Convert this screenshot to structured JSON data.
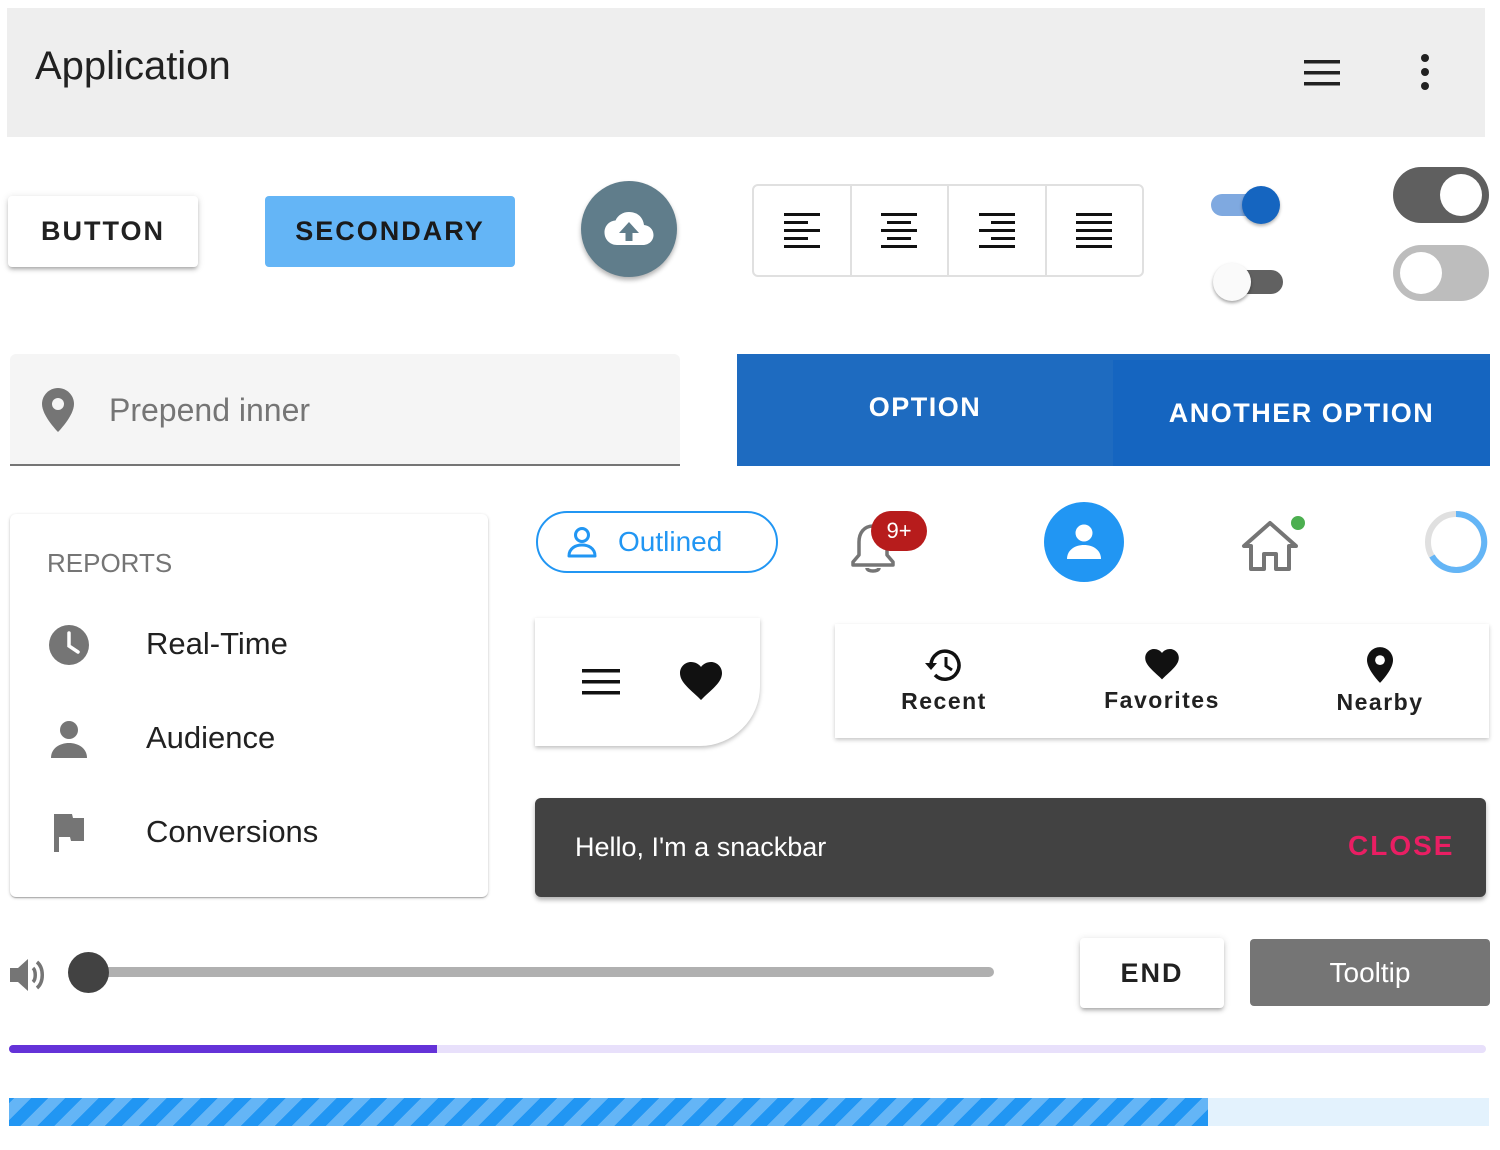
{
  "appbar": {
    "title": "Application",
    "menu_icon": "menu-icon",
    "more_icon": "more-vert-icon"
  },
  "buttons": {
    "elevated_label": "BUTTON",
    "secondary_label": "SECONDARY",
    "fab_icon": "cloud-upload-icon",
    "end_label": "END"
  },
  "toggle_group": {
    "items": [
      "align-left-icon",
      "align-center-icon",
      "align-right-icon",
      "align-justify-icon"
    ]
  },
  "switches": {
    "first": true,
    "second": false,
    "third": true,
    "fourth": false
  },
  "textfield": {
    "placeholder": "Prepend inner",
    "icon": "map-marker-icon"
  },
  "tabs": [
    {
      "label": "OPTION"
    },
    {
      "label": "ANOTHER OPTION"
    }
  ],
  "reports": {
    "header": "REPORTS",
    "items": [
      {
        "label": "Real-Time",
        "icon": "clock-icon"
      },
      {
        "label": "Audience",
        "icon": "account-icon"
      },
      {
        "label": "Conversions",
        "icon": "flag-icon"
      }
    ]
  },
  "chip": {
    "label": "Outlined",
    "icon": "account-outline-icon"
  },
  "badge": {
    "count": "9+",
    "icon": "bell-outline-icon"
  },
  "avatar": {
    "icon": "account-icon"
  },
  "home": {
    "icon": "home-outline-icon"
  },
  "bottom_nav": {
    "items": [
      {
        "label": "Recent",
        "icon": "history-icon"
      },
      {
        "label": "Favorites",
        "icon": "heart-icon"
      },
      {
        "label": "Nearby",
        "icon": "map-marker-icon"
      }
    ]
  },
  "snackbar": {
    "text": "Hello, I'm a snackbar",
    "action": "CLOSE"
  },
  "slider": {
    "icon": "volume-icon",
    "value": 0
  },
  "tooltip": {
    "label": "Tooltip"
  },
  "progress": {
    "linear_percent": 29,
    "striped_percent": 81
  },
  "colors": {
    "primary": "#1565c0",
    "secondary": "#64b5f6",
    "accent": "#e91e63",
    "fab": "#607d8b",
    "snackbar": "#424242",
    "progress": "#6432d8"
  }
}
